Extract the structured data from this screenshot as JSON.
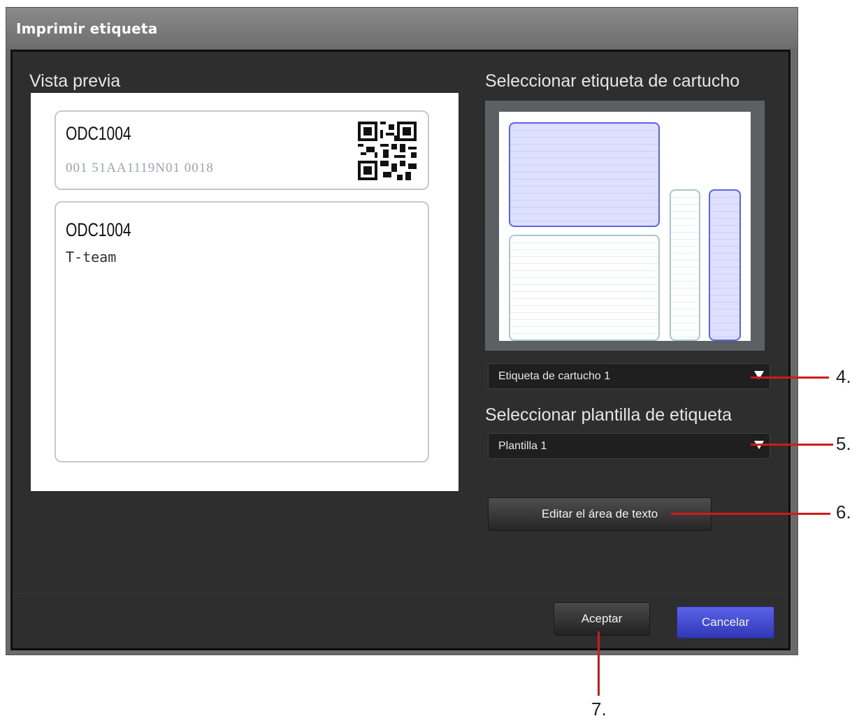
{
  "dialog": {
    "title": "Imprimir etiqueta"
  },
  "preview": {
    "heading": "Vista previa",
    "top_label": {
      "code": "ODC1004",
      "serial": "001 51AA1119N01 0018"
    },
    "bottom_label": {
      "code": "ODC1004",
      "team": "T-team"
    }
  },
  "cartridge": {
    "heading": "Seleccionar etiqueta de cartucho",
    "selected": "Etiqueta de cartucho 1"
  },
  "template": {
    "heading": "Seleccionar plantilla de etiqueta",
    "selected": "Plantilla 1"
  },
  "buttons": {
    "edit_text_area": "Editar el área de texto",
    "accept": "Aceptar",
    "cancel": "Cancelar"
  },
  "callouts": [
    "4.",
    "5.",
    "6.",
    "7."
  ],
  "colors": {
    "callout": "#d11a1a",
    "cancel_button": "#4149d2",
    "selected_slot": "#5a65e6"
  }
}
